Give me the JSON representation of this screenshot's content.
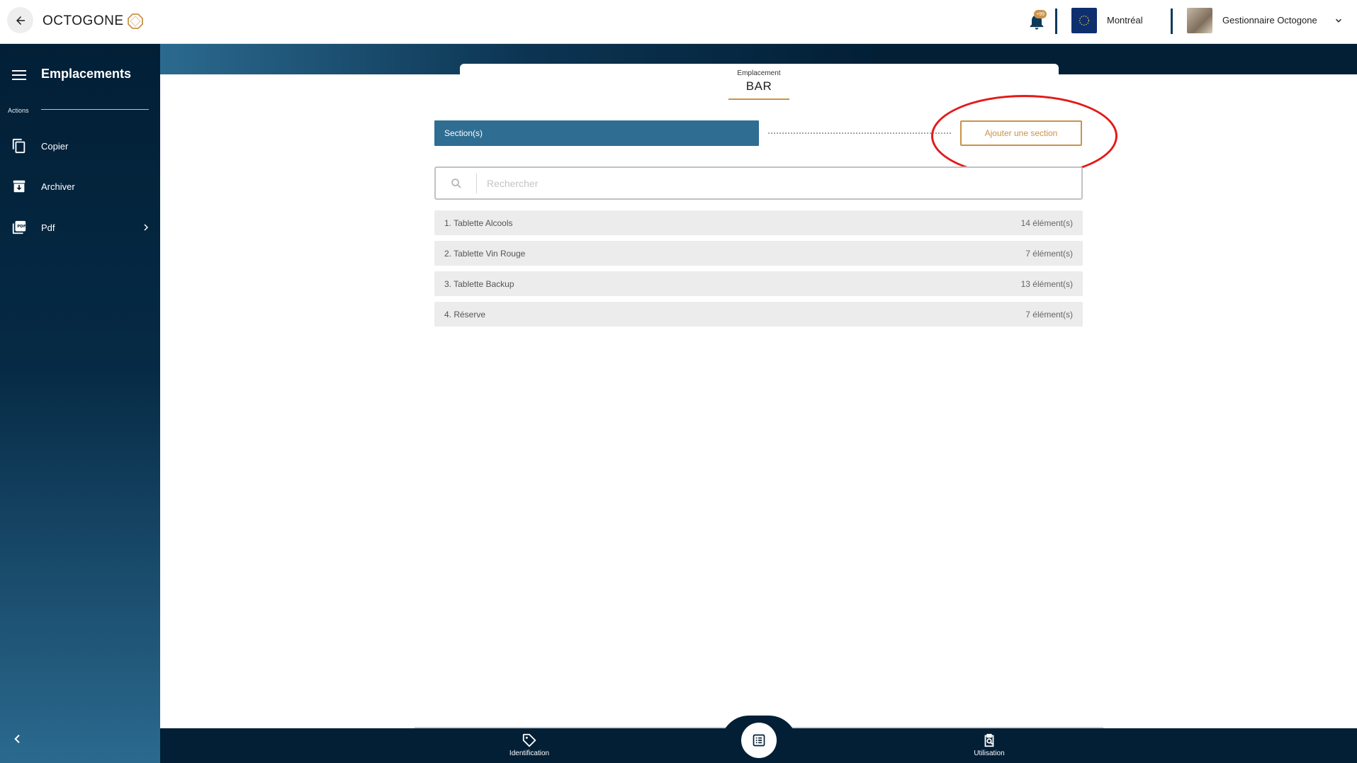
{
  "app": {
    "logo_text": "OCTOGONE"
  },
  "topbar": {
    "notifications_badge": "+99",
    "site_name": "Montréal",
    "user_name": "Gestionnaire Octogone"
  },
  "sidebar": {
    "title": "Emplacements",
    "actions_label": "Actions",
    "items": [
      {
        "label": "Copier",
        "icon": "copy-icon"
      },
      {
        "label": "Archiver",
        "icon": "archive-icon"
      },
      {
        "label": "Pdf",
        "icon": "pdf-icon"
      }
    ]
  },
  "header": {
    "location_label": "Emplacement",
    "location_name": "BAR"
  },
  "sections": {
    "header_label": "Section(s)",
    "add_button_label": "Ajouter une section",
    "search_placeholder": "Rechercher",
    "rows": [
      {
        "name": "1. Tablette Alcools",
        "count": "14 élément(s)"
      },
      {
        "name": "2. Tablette Vin Rouge",
        "count": "7 élément(s)"
      },
      {
        "name": "3. Tablette Backup",
        "count": "13 élément(s)"
      },
      {
        "name": "4. Réserve",
        "count": "7 élément(s)"
      }
    ]
  },
  "bottom_nav": {
    "left_label": "Identification",
    "right_label": "Utilisation"
  },
  "colors": {
    "navy": "#021f36",
    "accent_gold": "#c9934b",
    "section_blue": "#2f6d92",
    "highlight_red": "#e31a1a"
  }
}
